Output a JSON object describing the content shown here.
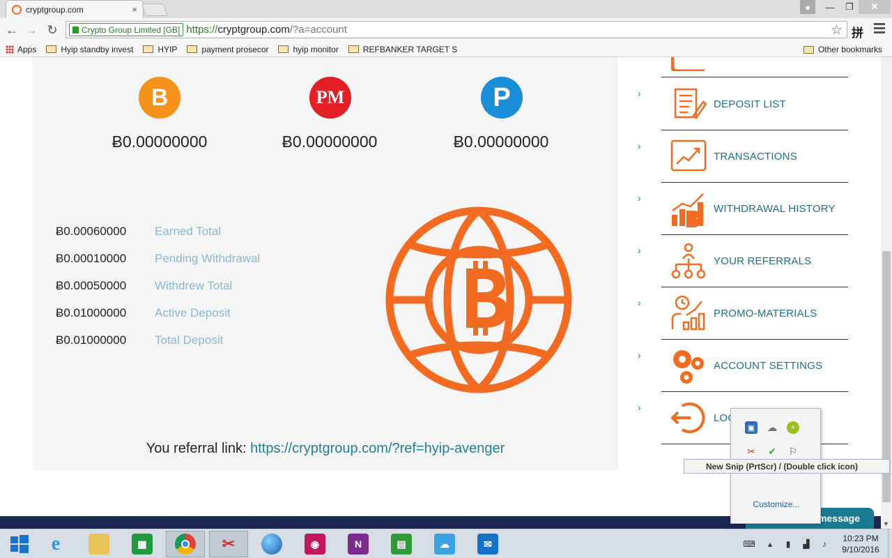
{
  "browser": {
    "tab_title": "cryptgroup.com",
    "tab_close": "×",
    "ev_name": "Crypto Group Limited [GB]",
    "url_scheme": "https://",
    "url_host": "cryptgroup.com",
    "url_path": "/?a=account",
    "ext_icon": "拼",
    "bookmarks": [
      {
        "label": "Apps",
        "icon": "apps-icon"
      },
      {
        "label": "Hyip standby invest",
        "icon": "folder-icon"
      },
      {
        "label": "HYIP",
        "icon": "folder-icon"
      },
      {
        "label": "payment prosecor",
        "icon": "folder-icon"
      },
      {
        "label": "hyip monitor",
        "icon": "folder-icon"
      },
      {
        "label": "REFBANKER TARGET S",
        "icon": "folder-icon"
      }
    ],
    "other_bookmarks": "Other bookmarks"
  },
  "wallets": [
    {
      "symbol": "B",
      "name": "bitcoin",
      "balance": "Ƀ0.00000000",
      "color": "#f7931a"
    },
    {
      "symbol": "PM",
      "name": "perfect-money",
      "balance": "Ƀ0.00000000",
      "color": "#e31e24"
    },
    {
      "symbol": "P",
      "name": "payeer",
      "balance": "Ƀ0.00000000",
      "color": "#1a8fd8"
    }
  ],
  "stats": [
    {
      "value": "Ƀ0.00060000",
      "label": "Earned Total"
    },
    {
      "value": "Ƀ0.00010000",
      "label": "Pending Withdrawal"
    },
    {
      "value": "Ƀ0.00050000",
      "label": "Withdrew Total"
    },
    {
      "value": "Ƀ0.01000000",
      "label": "Active Deposit"
    },
    {
      "value": "Ƀ0.01000000",
      "label": "Total Deposit"
    }
  ],
  "referral": {
    "prefix": "You referral link: ",
    "link": "https://cryptgroup.com/?ref=hyip-avenger"
  },
  "menu": {
    "chevron": "›",
    "items": [
      {
        "label": "DEPOSIT LIST",
        "icon": "list-icon"
      },
      {
        "label": "TRANSACTIONS",
        "icon": "chart-icon"
      },
      {
        "label": "WITHDRAWAL HISTORY",
        "icon": "bitcoin-bars-icon"
      },
      {
        "label": "YOUR REFERRALS",
        "icon": "referral-tree-icon"
      },
      {
        "label": "PROMO-MATERIALS",
        "icon": "promo-icon"
      },
      {
        "label": "ACCOUNT SETTINGS",
        "icon": "gears-icon"
      },
      {
        "label": "LOG",
        "icon": "logout-icon"
      }
    ]
  },
  "message_button": "message",
  "tray_popup": {
    "customize": "Customize...",
    "tooltip": "New Snip (PrtScr) / (Double click icon)"
  },
  "taskbar": {
    "time": "10:23 PM",
    "date": "9/10/2016"
  },
  "colors": {
    "accent_orange": "#f36b21",
    "link_teal": "#1f7f95",
    "label_blue": "#8bb8d1",
    "footer_navy": "#1c2851"
  }
}
